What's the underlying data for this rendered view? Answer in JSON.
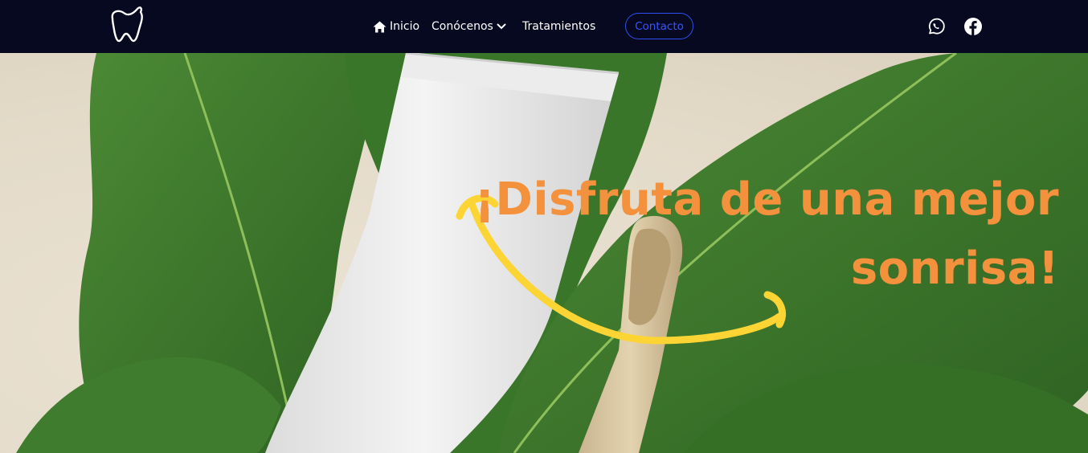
{
  "nav": {
    "logo_icon": "tooth-icon",
    "items": [
      {
        "label": "Inicio",
        "icon": "home-icon"
      },
      {
        "label": "Conócenos",
        "icon": "chevron-down-icon"
      },
      {
        "label": "Tratamientos"
      }
    ],
    "contact_label": "Contacto",
    "social": [
      {
        "icon": "whatsapp-icon"
      },
      {
        "icon": "facebook-icon"
      }
    ]
  },
  "hero": {
    "title": "¡Disfruta de una mejor sonrisa!"
  },
  "colors": {
    "nav_bg": "#070920",
    "accent_blue": "#2f4ff0",
    "title_orange": "#f4913d",
    "smile_yellow": "#fcd535",
    "leaf_green": "#3c7a2c"
  }
}
